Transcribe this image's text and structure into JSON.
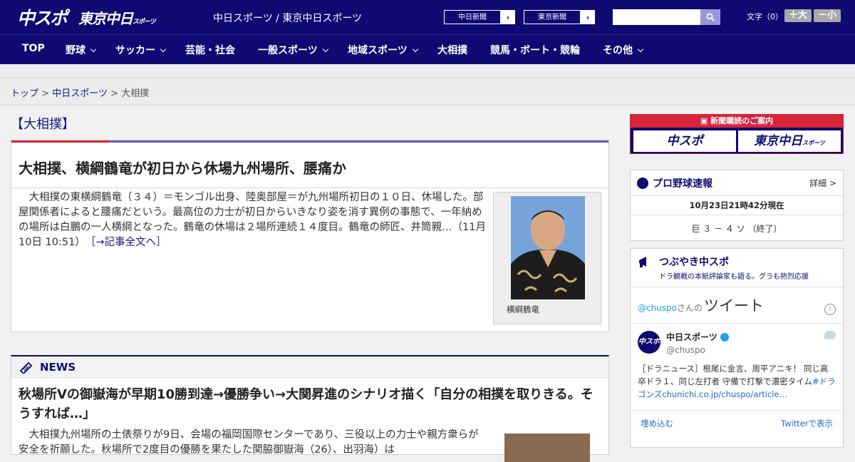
{
  "header": {
    "logo_chuspo": "中スポ",
    "logo_tokyo": "東京中日",
    "logo_tokyo_sub": "スポーツ",
    "site_names": "中日スポーツ / 東京中日スポーツ",
    "link_chunichi": "中日新聞",
    "link_tokyo": "東京新聞",
    "font_size_label": "文字（0）",
    "font_bigger": "＋大",
    "font_smaller": "－小"
  },
  "nav": [
    {
      "label": "TOP",
      "dropdown": false
    },
    {
      "label": "野球",
      "dropdown": true
    },
    {
      "label": "サッカー",
      "dropdown": true
    },
    {
      "label": "芸能・社会",
      "dropdown": false
    },
    {
      "label": "一般スポーツ",
      "dropdown": true
    },
    {
      "label": "地域スポーツ",
      "dropdown": true
    },
    {
      "label": "大相撲",
      "dropdown": false
    },
    {
      "label": "競馬・ボート・競輪",
      "dropdown": false
    },
    {
      "label": "その他",
      "dropdown": true
    }
  ],
  "breadcrumb": {
    "home": "トップ",
    "sep": " > ",
    "section": "中日スポーツ",
    "current": "大相撲"
  },
  "main": {
    "section_title": "【大相撲】",
    "article": {
      "headline": "大相撲、横綱鶴竜が初日から休場九州場所、腰痛か",
      "body": "　大相撲の東横綱鶴竜（３４）＝モンゴル出身、陸奥部屋＝が九州場所初日の１０日、休場した。部屋関係者によると腰痛だという。最高位の力士が初日からいきなり姿を消す異例の事態で、一年納めの場所は白鵬の一人横綱となった。鶴竜の休場は２場所連続１４度目。鶴竜の師匠、井筒親…（11月10日 10:51）",
      "more_link": "［→記事全文へ］",
      "photo_caption": "横綱鶴竜"
    },
    "news": {
      "header": "NEWS",
      "headline": "秋場所Vの御嶽海が早期10勝到達→優勝争い→大関昇進のシナリオ描く「自分の相撲を取りきる。そうすれば…」",
      "body": "　大相撲九州場所の土俵祭りが9日、会場の福岡国際センターであり、三役以上の力士や親方衆らが安全を祈願した。秋場所で2度目の優勝を果たした関脇御嶽海（26）、出羽海）は"
    }
  },
  "sidebar": {
    "subscribe_label": "新聞購読のご案内",
    "sub_chuspo": "中スポ",
    "sub_tokyo": "東京中日",
    "sub_tokyo_small": "スポーツ",
    "baseball": {
      "title": "プロ野球速報",
      "detail": "詳細 >",
      "as_of": "10月23日21時42分現在",
      "score": "巨 ３ － ４ ソ （終了）"
    },
    "tweets": {
      "title": "つぶやき中スポ",
      "subtitle": "ドラ観戦の本紙評論家も語る。グラも熱烈応援",
      "handle_prefix": "@chuspo",
      "handle_suffix": "さんの",
      "tweets_word": "ツイート",
      "info": "i",
      "avatar": "中スポ",
      "user_name": "中日スポーツ",
      "user_handle": "@chuspo",
      "tweet_text": "［ドラニュース］根尾に金言、周平アニキ！ 同じ高卒ドラ１、同じ左打者 守備で打撃で濃密タイム",
      "tweet_link": "#ドラゴンズchunichi.co.jp/chuspo/article…",
      "embed": "埋め込む",
      "view_on_twitter": "Twitterで表示"
    }
  },
  "colors": {
    "brand_navy": "#0e0a72",
    "accent_red": "#d9253c",
    "accent_purple": "#6a62b3",
    "link_blue": "#17178a"
  }
}
